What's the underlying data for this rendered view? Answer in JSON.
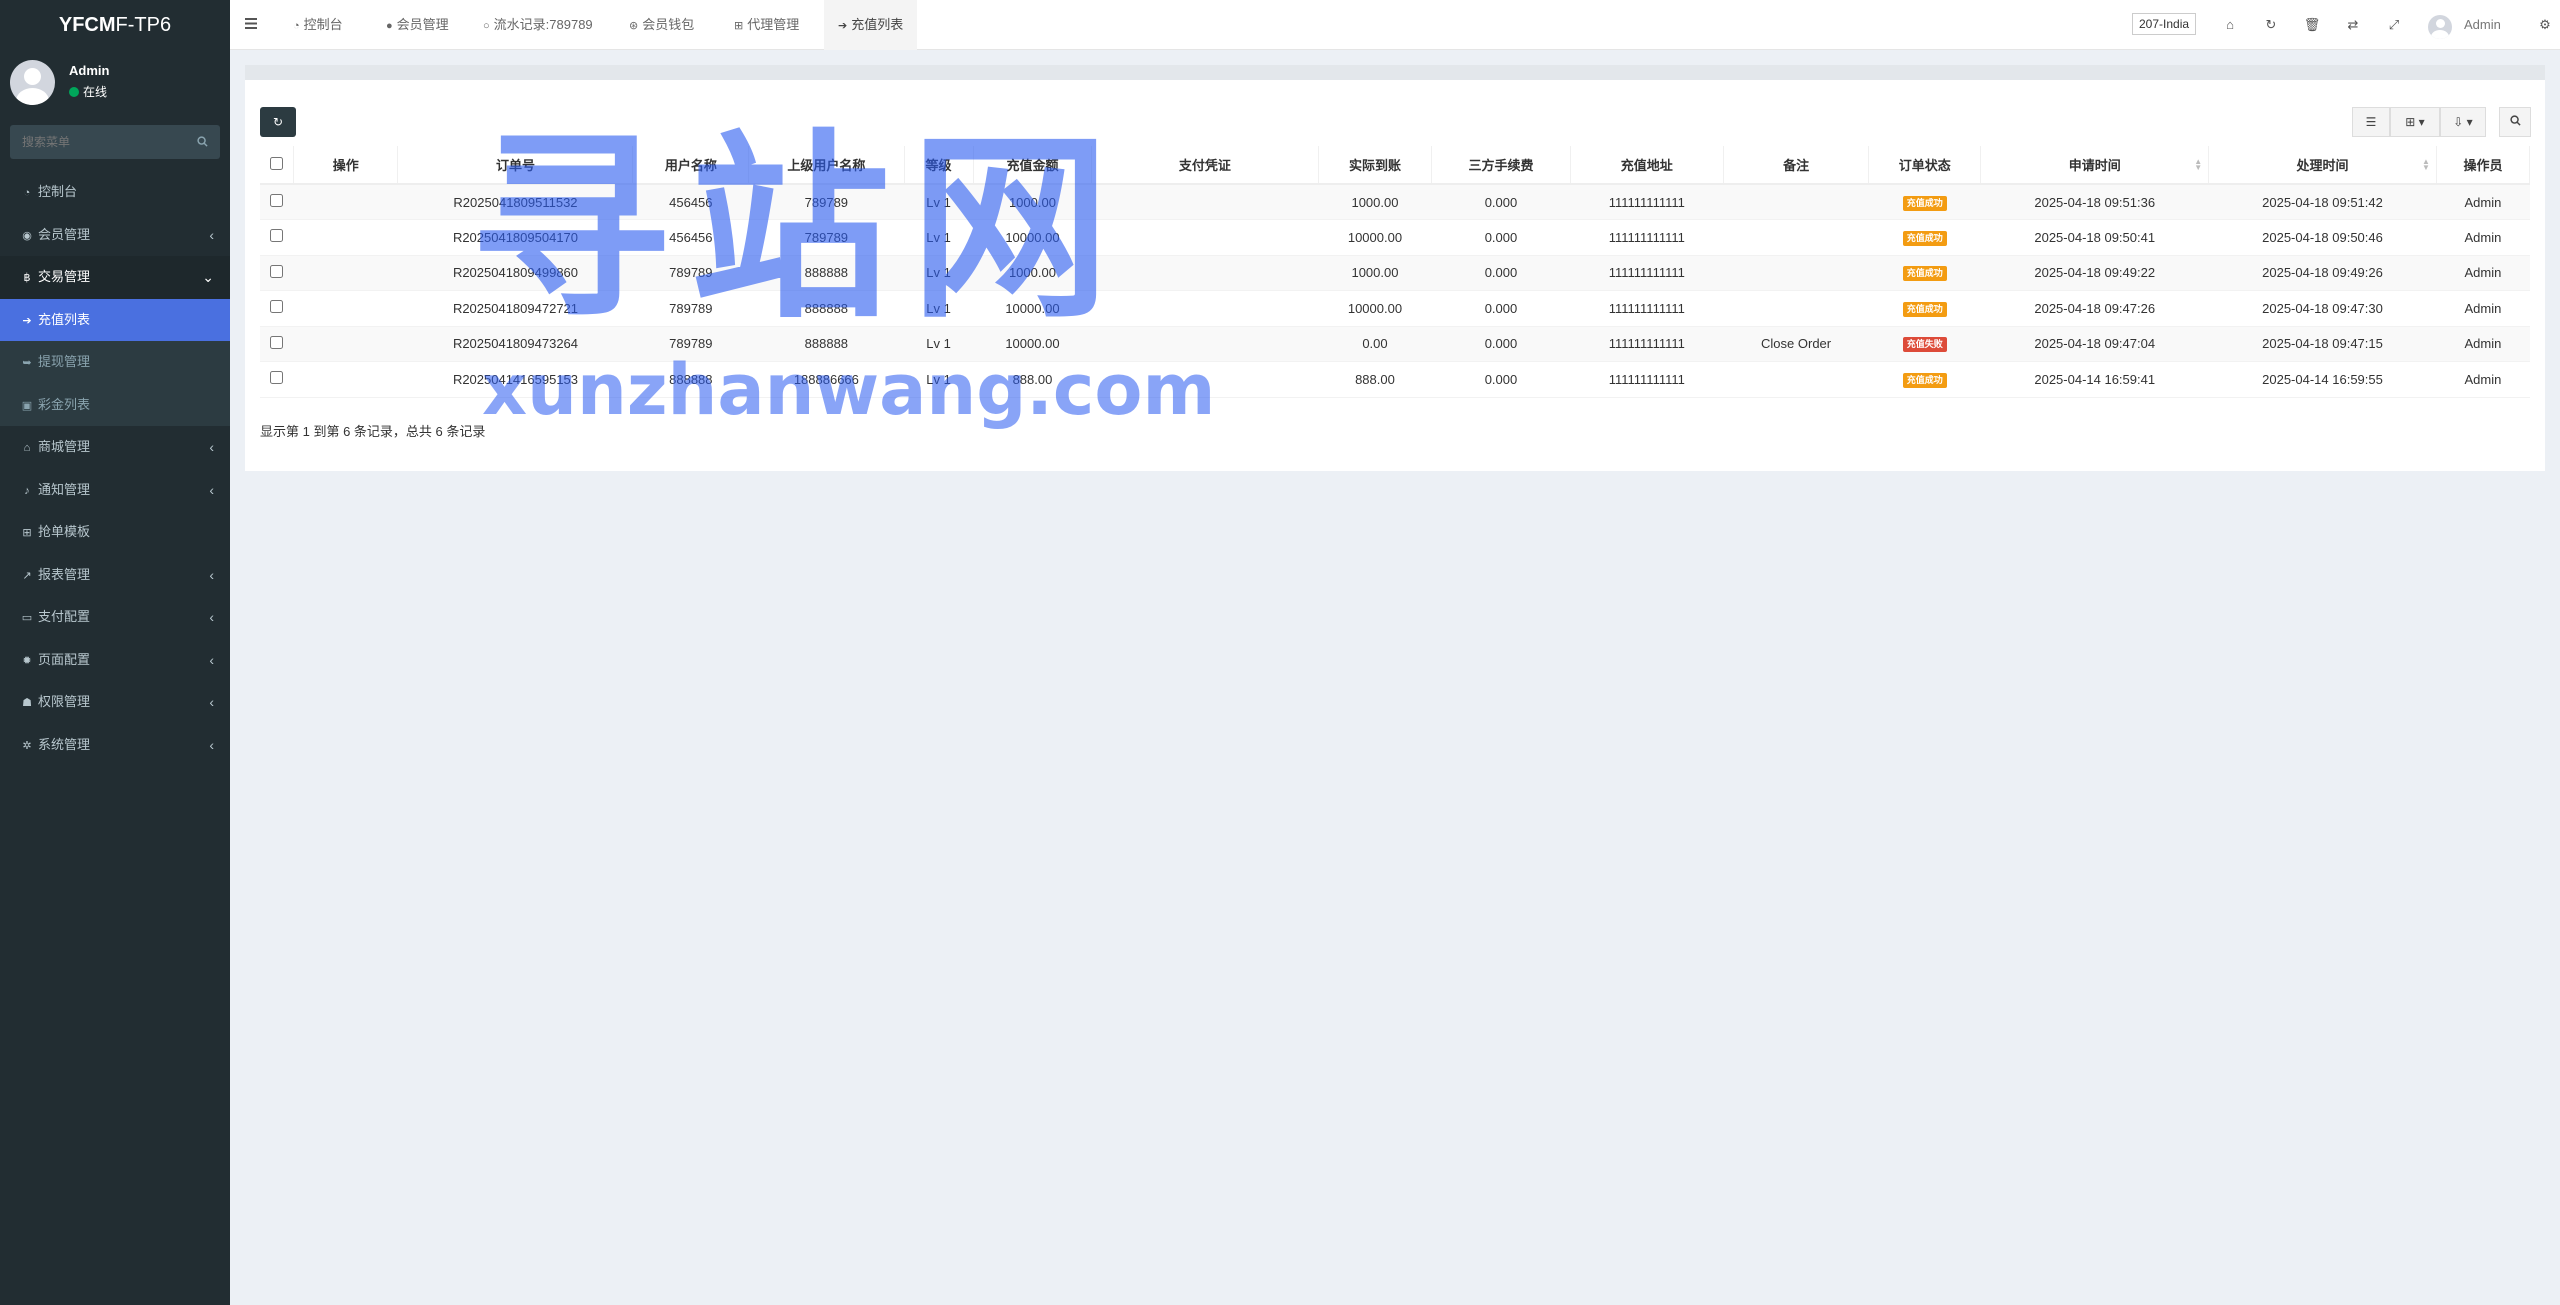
{
  "brand": {
    "bold": "YFCM",
    "rest": "F-TP6"
  },
  "user": {
    "name": "Admin",
    "status": "在线"
  },
  "search": {
    "placeholder": "搜索菜单"
  },
  "menu": [
    {
      "label": "控制台",
      "icon": "dashboard-icon"
    },
    {
      "label": "会员管理",
      "icon": "user-circle-icon"
    },
    {
      "label": "交易管理",
      "icon": "bitcoin-icon"
    },
    {
      "label": "充值列表",
      "icon": "sign-in-icon"
    },
    {
      "label": "提现管理",
      "icon": "sign-out-icon"
    },
    {
      "label": "彩金列表",
      "icon": "gift-icon"
    },
    {
      "label": "商城管理",
      "icon": "home-icon"
    },
    {
      "label": "通知管理",
      "icon": "bell-icon"
    },
    {
      "label": "抢单模板",
      "icon": "sitemap-icon"
    },
    {
      "label": "报表管理",
      "icon": "line-chart-icon"
    },
    {
      "label": "支付配置",
      "icon": "credit-card-icon"
    },
    {
      "label": "页面配置",
      "icon": "cog-icon"
    },
    {
      "label": "权限管理",
      "icon": "group-icon"
    },
    {
      "label": "系统管理",
      "icon": "cogs-icon"
    }
  ],
  "tabs": [
    {
      "label": "控制台",
      "icon": "dashboard-icon"
    },
    {
      "label": "会员管理",
      "icon": "user-icon"
    },
    {
      "label": "流水记录:789789",
      "icon": "circle-o-icon"
    },
    {
      "label": "会员钱包",
      "icon": "wallet-icon"
    },
    {
      "label": "代理管理",
      "icon": "sitemap-icon"
    },
    {
      "label": "充值列表",
      "icon": "sign-in-icon"
    }
  ],
  "header": {
    "lang": "207-India",
    "admin": "Admin"
  },
  "table": {
    "columns": [
      "操作",
      "订单号",
      "用户名称",
      "上级用户名称",
      "等级",
      "充值金额",
      "支付凭证",
      "实际到账",
      "三方手续费",
      "充值地址",
      "备注",
      "订单状态",
      "申请时间",
      "处理时间",
      "操作员"
    ],
    "rows": [
      {
        "order": "R2025041809511532",
        "user": "456456",
        "parent": "789789",
        "level": "Lv 1",
        "amount": "1000.00",
        "proof": "",
        "actual": "1000.00",
        "fee": "0.000",
        "address": "111111111111",
        "remark": "",
        "status": "充值成功",
        "status_type": "ok",
        "apply": "2025-04-18 09:51:36",
        "process": "2025-04-18 09:51:42",
        "operator": "Admin"
      },
      {
        "order": "R2025041809504170",
        "user": "456456",
        "parent": "789789",
        "level": "Lv 1",
        "amount": "10000.00",
        "proof": "",
        "actual": "10000.00",
        "fee": "0.000",
        "address": "111111111111",
        "remark": "",
        "status": "充值成功",
        "status_type": "ok",
        "apply": "2025-04-18 09:50:41",
        "process": "2025-04-18 09:50:46",
        "operator": "Admin"
      },
      {
        "order": "R2025041809499860",
        "user": "789789",
        "parent": "888888",
        "level": "Lv 1",
        "amount": "1000.00",
        "proof": "",
        "actual": "1000.00",
        "fee": "0.000",
        "address": "111111111111",
        "remark": "",
        "status": "充值成功",
        "status_type": "ok",
        "apply": "2025-04-18 09:49:22",
        "process": "2025-04-18 09:49:26",
        "operator": "Admin"
      },
      {
        "order": "R2025041809472721",
        "user": "789789",
        "parent": "888888",
        "level": "Lv 1",
        "amount": "10000.00",
        "proof": "",
        "actual": "10000.00",
        "fee": "0.000",
        "address": "111111111111",
        "remark": "",
        "status": "充值成功",
        "status_type": "ok",
        "apply": "2025-04-18 09:47:26",
        "process": "2025-04-18 09:47:30",
        "operator": "Admin"
      },
      {
        "order": "R2025041809473264",
        "user": "789789",
        "parent": "888888",
        "level": "Lv 1",
        "amount": "10000.00",
        "proof": "",
        "actual": "0.00",
        "fee": "0.000",
        "address": "111111111111",
        "remark": "Close Order",
        "status": "充值失败",
        "status_type": "fail",
        "apply": "2025-04-18 09:47:04",
        "process": "2025-04-18 09:47:15",
        "operator": "Admin"
      },
      {
        "order": "R2025041416595153",
        "user": "888888",
        "parent": "188886666",
        "level": "Lv 1",
        "amount": "888.00",
        "proof": "",
        "actual": "888.00",
        "fee": "0.000",
        "address": "111111111111",
        "remark": "",
        "status": "充值成功",
        "status_type": "ok",
        "apply": "2025-04-14 16:59:41",
        "process": "2025-04-14 16:59:55",
        "operator": "Admin"
      }
    ]
  },
  "pager": {
    "info": "显示第 1 到第 6 条记录，总共 6 条记录"
  },
  "watermark": {
    "cn": "寻站网",
    "en": "xunzhanwang.com"
  },
  "colors": {
    "sidebar": "#222d32",
    "active": "#4a70e0",
    "success_badge": "#f39c12",
    "fail_badge": "#dd4b39"
  }
}
